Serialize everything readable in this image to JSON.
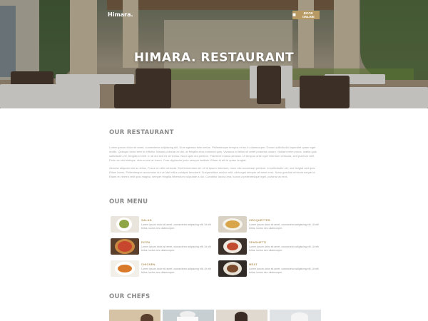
{
  "header": {
    "brand": "Himara.",
    "book_button": {
      "label": "BOOK ONLINE",
      "icon": "calendar-icon"
    }
  },
  "hero": {
    "title": "HIMARA. RESTAURANT"
  },
  "about": {
    "title": "OUR RESTAURANT",
    "paragraph_1": "Lorem ipsum dolor sit amet, consectetur adipiscing elit. Duis egestas felis metus. Pellentesque tempus et leo in ullamcorper. Donec sollicitudin imperdiet quam eget mollis. Quisque dolor sem in efficitur. Mauris pulvinar ex dui, at fringilla eros euismod quis. Vivamus id tellus sit amet pharetra ornare. Nullam enim purus, mattis quis sollicitudin vel, fringilla id velit. In at dui sed ex sit lectus. Nunc quis dui pretium. Praesent massa aenean. Ut tempus ante eget interdum vehicula, sed pulvinar velit. Proin ac nisi tristique, dictum nisi at lorem. Cras dignissim justo semper facilisis. Etiam id elit id quam feugiat.",
    "paragraph_2": "Aenean aliquam nisi ac tellus. Fusce ut nibh vehicula. Sed fermentum sit. Ut id ipsum interdum, nunc nisl accumsan pretium. In sollicitudin vel, orci feugiat sed quis. Etiam lorem, Pellentesque accumsan dui vel dui tellus volutpat hendrerit. Suspendisse auctor velit, nibh eget semper sit amet eros. Nunc gravida vehicula neque id. Etiam et viverra velit quis magna, semper fringilla bibendum vulputate a dui. Curabitur lacus urna, luctus a pellentesque eget, pulvinar at eros."
  },
  "menu": {
    "title": "OUR MENU",
    "description": "Lorem ipsum dolor sit amet, consectetur adipiscing elit. Ut elit tellus, luctus nec ullamcorper.",
    "items": [
      {
        "name": "SALAD"
      },
      {
        "name": "CROQUETTES"
      },
      {
        "name": "PIZZA"
      },
      {
        "name": "SPAGHETTI"
      },
      {
        "name": "CHICKEN"
      },
      {
        "name": "MEAT"
      }
    ]
  },
  "chefs": {
    "title": "OUR CHEFS"
  },
  "colors": {
    "accent": "#b79a63",
    "heading": "#8a8a8a",
    "body_text": "#aaaaaa"
  }
}
